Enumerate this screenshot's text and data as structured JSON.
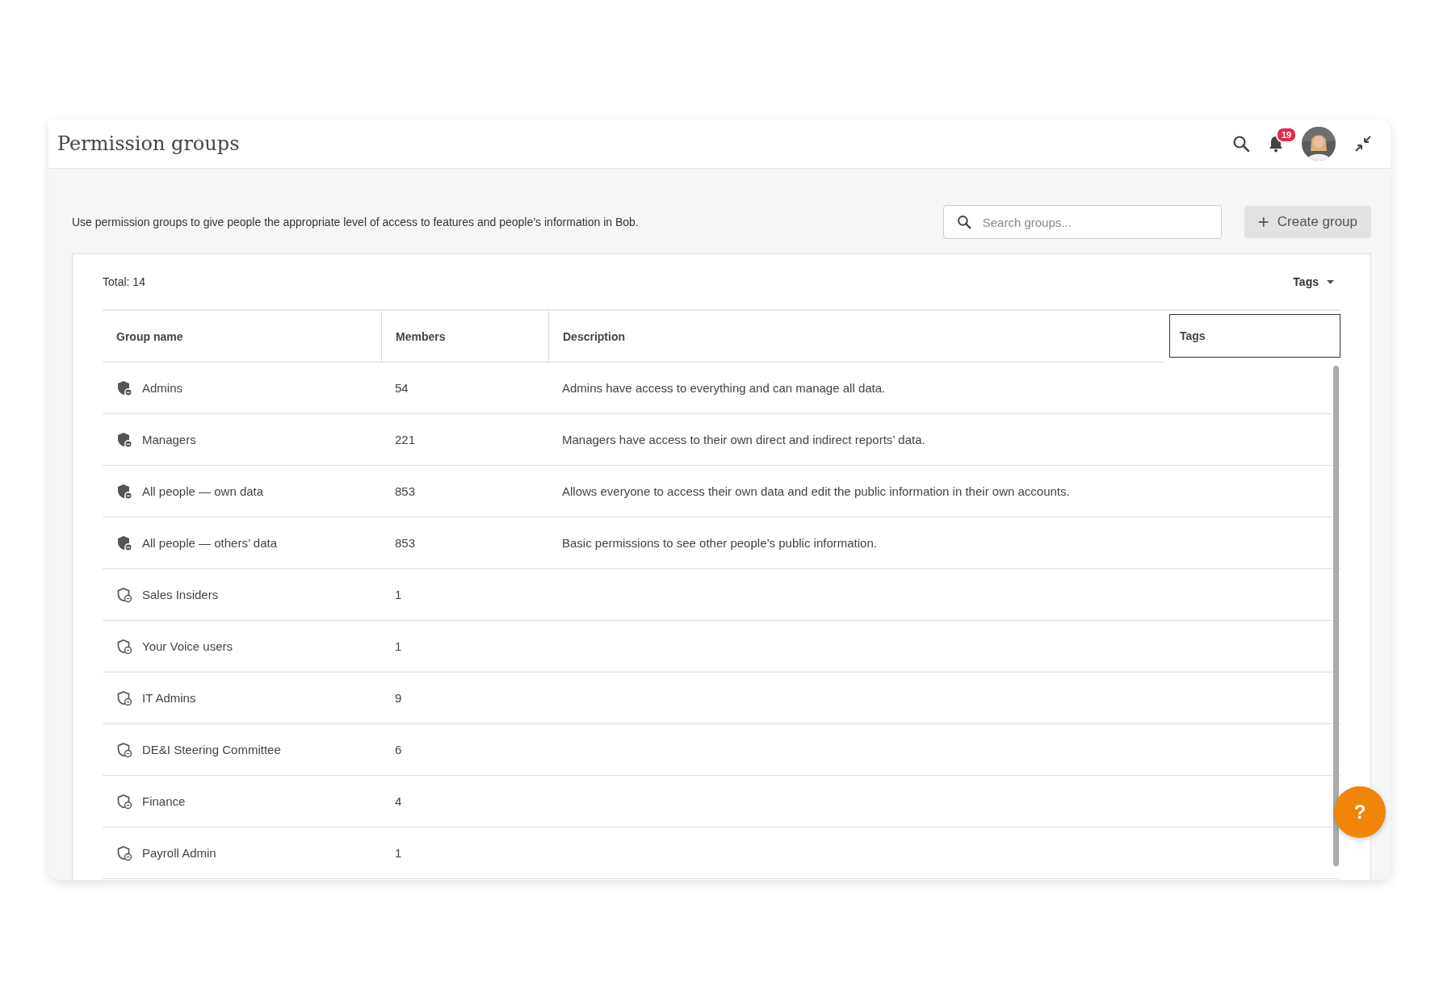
{
  "header": {
    "title": "Permission groups",
    "notifications": "19"
  },
  "intro": "Use permission groups to give people the appropriate level of access to features and people’s information in Bob.",
  "search": {
    "placeholder": "Search groups..."
  },
  "create_button": {
    "icon": "+",
    "label": "Create group"
  },
  "total": "Total: 14",
  "tags_filter": "Tags",
  "table": {
    "columns": [
      "Group name",
      "Members",
      "Description",
      "Tags"
    ],
    "rows": [
      {
        "kind": "system",
        "name": "Admins",
        "members": "54",
        "description": "Admins have access to everything and can manage all data."
      },
      {
        "kind": "system",
        "name": "Managers",
        "members": "221",
        "description": "Managers have access to their own direct and indirect reports’ data."
      },
      {
        "kind": "system",
        "name": "All people — own data",
        "members": "853",
        "description": "Allows everyone to access their own data and edit the public information in their own accounts."
      },
      {
        "kind": "system",
        "name": "All people — others’ data",
        "members": "853",
        "description": "Basic permissions to see other people’s public information."
      },
      {
        "kind": "custom",
        "name": "Sales Insiders",
        "members": "1"
      },
      {
        "kind": "custom",
        "name": "Your Voice users",
        "members": "1"
      },
      {
        "kind": "custom",
        "name": "IT Admins",
        "members": "9"
      },
      {
        "kind": "custom",
        "name": "DE&I Steering Committee",
        "members": "6"
      },
      {
        "kind": "custom",
        "name": "Finance",
        "members": "4"
      },
      {
        "kind": "custom",
        "name": "Payroll Admin",
        "members": "1"
      }
    ]
  },
  "help_button": "?"
}
